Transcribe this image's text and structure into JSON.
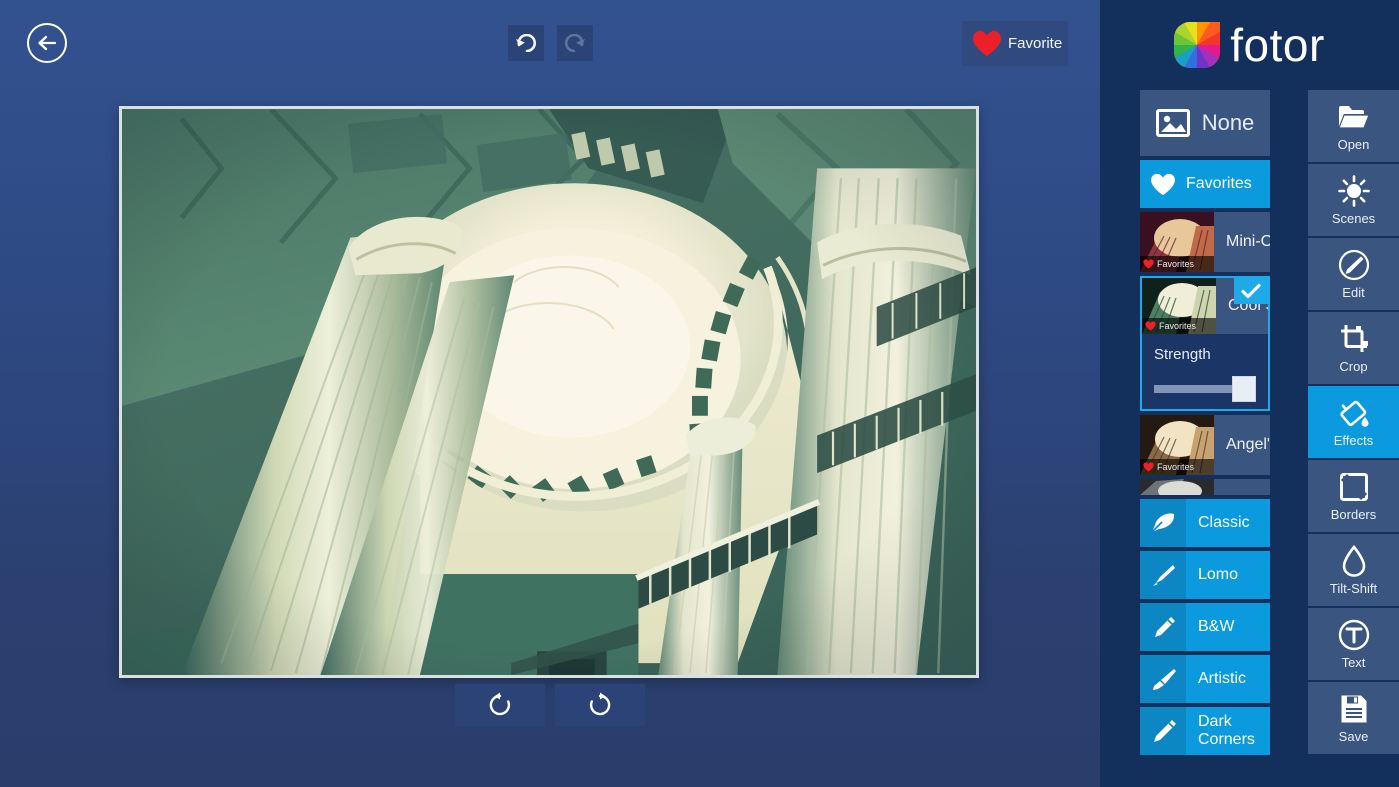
{
  "app": {
    "brand_name": "fotor",
    "logo_icon": "fotor-color-wheel-logo"
  },
  "topbar": {
    "back_icon": "arrow-left-circle-icon",
    "undo_icon": "undo-arrow-icon",
    "redo_icon": "redo-arrow-icon",
    "favorite_label": "Favorite",
    "favorite_icon": "heart-icon"
  },
  "canvas": {
    "rotate_left_icon": "rotate-counterclockwise-icon",
    "rotate_right_icon": "rotate-clockwise-icon",
    "photo_description": "Interior view looking up into a classical rotunda dome with fluted columns, teal-green color cast"
  },
  "effects_panel": {
    "none_label": "None",
    "none_icon": "image-placeholder-icon",
    "favorites_label": "Favorites",
    "favorites_icon": "heart-icon",
    "favorite_tag_label": "Favorites",
    "filters": [
      {
        "name": "Mini-Oven",
        "tag": "Favorites",
        "selected": false
      },
      {
        "name": "Cool Summer",
        "tag": "Favorites",
        "selected": true
      },
      {
        "name": "Angel's Kiss",
        "tag": "Favorites",
        "selected": false
      }
    ],
    "selected_filter": {
      "name": "Cool Summer",
      "tag": "Favorites",
      "check_icon": "checkmark-icon",
      "strength_label": "Strength",
      "strength_value": 100
    },
    "categories": [
      {
        "label": "Classic",
        "icon": "feather-pen-icon"
      },
      {
        "label": "Lomo",
        "icon": "brush-pen-icon"
      },
      {
        "label": "B&W",
        "icon": "pencil-icon"
      },
      {
        "label": "Artistic",
        "icon": "paint-brush-icon"
      },
      {
        "label": "Dark Corners",
        "icon": "pencil-icon"
      }
    ]
  },
  "toolbar": {
    "items": [
      {
        "label": "Open",
        "icon": "folder-icon",
        "active": false
      },
      {
        "label": "Scenes",
        "icon": "sun-icon",
        "active": false
      },
      {
        "label": "Edit",
        "icon": "pencil-circle-icon",
        "active": false
      },
      {
        "label": "Crop",
        "icon": "crop-icon",
        "active": false
      },
      {
        "label": "Effects",
        "icon": "paint-bucket-icon",
        "active": true
      },
      {
        "label": "Borders",
        "icon": "frame-icon",
        "active": false
      },
      {
        "label": "Tilt-Shift",
        "icon": "droplet-icon",
        "active": false
      },
      {
        "label": "Text",
        "icon": "text-t-icon",
        "active": false
      },
      {
        "label": "Save",
        "icon": "floppy-disk-icon",
        "active": false
      }
    ]
  },
  "colors": {
    "background_top": "#32528f",
    "background_bottom": "#2a3e6c",
    "panel": "#12305b",
    "tile": "#3a5580",
    "accent": "#0b9ade",
    "selection_border": "#1ea9e8",
    "favorite_heart": "#ec2026"
  }
}
